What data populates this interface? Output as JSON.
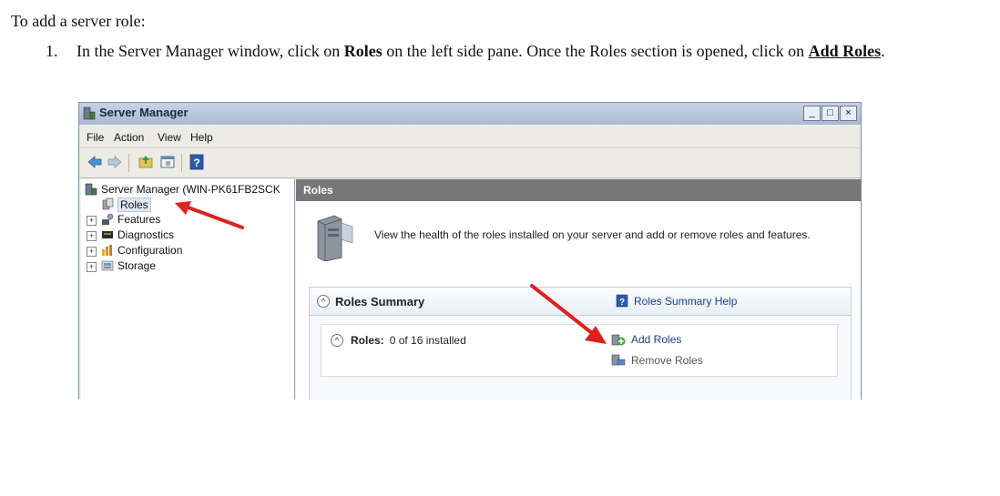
{
  "doc": {
    "intro": "To add a server role:",
    "step_number": "1.",
    "step_part1": "In the Server Manager window, click on ",
    "step_bold_roles": "Roles",
    "step_part2": " on the left side pane. Once the Roles section is opened, click on ",
    "step_bold_add_roles": "Add Roles",
    "step_end": "."
  },
  "window": {
    "title": "Server Manager",
    "buttons": [
      "_",
      "□",
      "×"
    ],
    "menu": [
      "File",
      "Action",
      "View",
      "Help"
    ]
  },
  "tree": {
    "root": "Server Manager (WIN-PK61FB2SCK",
    "items": [
      "Roles",
      "Features",
      "Diagnostics",
      "Configuration",
      "Storage"
    ]
  },
  "content": {
    "header": "Roles",
    "description": "View the health of the roles installed on your server and add or remove roles and features.",
    "summary_title": "Roles Summary",
    "help_link": "Roles Summary Help",
    "roles_label": "Roles:",
    "roles_count": "0 of 16 installed",
    "add_roles": "Add Roles",
    "remove_roles": "Remove Roles"
  },
  "colors": {
    "arrow": "#e02020",
    "link": "#1a3e8a",
    "header": "#76777a"
  },
  "icons": [
    "server-manager-icon",
    "back-icon",
    "forward-icon",
    "up-icon",
    "console-icon",
    "help-icon",
    "roles-icon",
    "features-icon",
    "diagnostics-icon",
    "configuration-icon",
    "storage-icon",
    "server-tower-icon",
    "add-roles-icon",
    "remove-roles-icon"
  ]
}
